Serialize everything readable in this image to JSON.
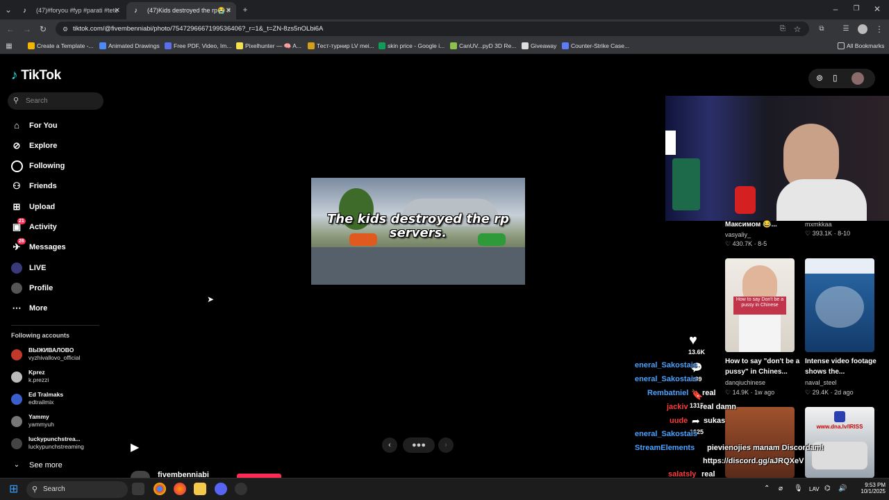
{
  "browser": {
    "tabs": [
      {
        "title": "(47)#foryou #fyp #parati #tete",
        "active": false
      },
      {
        "title": "(47)Kids destroyed the rp😭 #",
        "active": true
      }
    ],
    "url": "tiktok.com/@fivembenniabi/photo/7547296667199536406?_r=1&_t=ZN-8zs5nOLbi6A",
    "bookmarks": [
      {
        "label": "Create a Template -...",
        "color": "#f4b400"
      },
      {
        "label": "Animated Drawings",
        "color": "#4c8bf5"
      },
      {
        "label": "Free PDF, Video, Im...",
        "color": "#5a6cf0"
      },
      {
        "label": "Pixelhunter — 🧠 A...",
        "color": "#f5e050"
      },
      {
        "label": "Тест-турнир LV mei...",
        "color": "#d4a017"
      },
      {
        "label": "skin price - Google i...",
        "color": "#0f9d58"
      },
      {
        "label": "CanUV...pyD 3D Re...",
        "color": "#8bc34a"
      },
      {
        "label": "Giveaway",
        "color": "#ddd"
      },
      {
        "label": "Counter-Strike Case...",
        "color": "#5c7cfa"
      }
    ],
    "all_bookmarks": "All Bookmarks"
  },
  "sidebar": {
    "logo": "TikTok",
    "search_placeholder": "Search",
    "nav": [
      {
        "label": "For You",
        "icon": "home-icon"
      },
      {
        "label": "Explore",
        "icon": "compass-icon"
      },
      {
        "label": "Following",
        "icon": "following-icon"
      },
      {
        "label": "Friends",
        "icon": "friends-icon"
      },
      {
        "label": "Upload",
        "icon": "upload-icon"
      },
      {
        "label": "Activity",
        "icon": "activity-icon",
        "badge": "21"
      },
      {
        "label": "Messages",
        "icon": "messages-icon",
        "badge": "26"
      },
      {
        "label": "LIVE",
        "icon": "live-icon"
      },
      {
        "label": "Profile",
        "icon": "profile-icon"
      },
      {
        "label": "More",
        "icon": "more-icon"
      }
    ],
    "following_title": "Following accounts",
    "following": [
      {
        "name": "ВЫЖИВАЛОВО",
        "handle": "vyzhivallovo_official",
        "color": "#c0392b"
      },
      {
        "name": "Kprez",
        "handle": "k.prezzi",
        "color": "#bbb"
      },
      {
        "name": "Ed Tralmaks",
        "handle": "edtrailmix",
        "color": "#3a5fcd"
      },
      {
        "name": "Yammy",
        "handle": "yammyuh",
        "color": "#777"
      },
      {
        "name": "luckypunchstrea...",
        "handle": "luckypunchstreaming",
        "color": "#444"
      }
    ],
    "see_more": "See more"
  },
  "post": {
    "caption": "The kids destroyed the rp servers.",
    "author": "fivembenniabi",
    "likes": "13.6K",
    "comments": "189",
    "saves": "1315",
    "shares": "1625"
  },
  "recommendations": [
    {
      "title": "Максимом 😂...",
      "author": "vasyaliy_",
      "meta": "♡ 430.7K · 8-5"
    },
    {
      "title": "",
      "author": "mxmkkaa",
      "meta": "♡ 393.1K · 8-10"
    },
    {
      "title": "How to say \"don't be a pussy\" in Chines...",
      "author": "danqiuchinese",
      "meta": "♡ 14.9K · 1w ago",
      "thumb_text": "How to say Don't be a pussy in Chinese"
    },
    {
      "title": "Intense video footage shows the...",
      "author": "naval_steel",
      "meta": "♡ 29.4K · 2d ago"
    },
    {
      "title": "",
      "author": "",
      "meta": ""
    },
    {
      "title": "",
      "author": "",
      "meta": "",
      "thumb_text": "www.dna.lv/IRISS"
    }
  ],
  "overlay_chat": [
    {
      "text": "eneral_Sakostais",
      "color": "blue"
    },
    {
      "text": "eneral_Sakostais",
      "color": "blue"
    },
    {
      "text": "Rembatniel",
      "color": "blue"
    },
    {
      "text": "real",
      "color": "white"
    },
    {
      "text": "jackiv",
      "color": "red"
    },
    {
      "text": "real damn",
      "color": "white"
    },
    {
      "text": "uude",
      "color": "red"
    },
    {
      "text": "sukas",
      "color": "white"
    },
    {
      "text": "eneral_Sakostais",
      "color": "blue"
    },
    {
      "text": "StreamElements",
      "color": "blue"
    },
    {
      "text": "pievienojies manam Discordam!",
      "color": "white"
    },
    {
      "text": "https://discord.gg/aJRQXeV",
      "color": "white"
    },
    {
      "text": "salatsly",
      "color": "red"
    },
    {
      "text": "real",
      "color": "white"
    },
    {
      "text": "eneral_Sakostais",
      "color": "blue"
    }
  ],
  "taskbar": {
    "search": "Search",
    "lang": "LAV",
    "time": "9:53 PM",
    "date": "10/1/2025"
  }
}
